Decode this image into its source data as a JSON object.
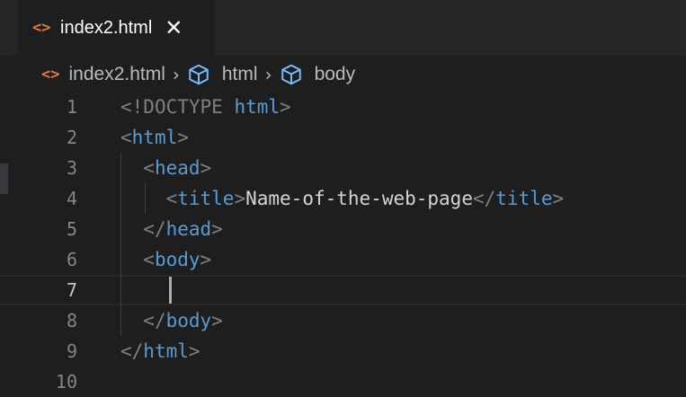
{
  "tab": {
    "label": "index2.html",
    "icon": "html-file-icon",
    "icon_glyph": "<>",
    "close_glyph": "✕"
  },
  "breadcrumb": {
    "file": "index2.html",
    "items": [
      "html",
      "body"
    ],
    "separator": "›"
  },
  "editor": {
    "line_numbers": [
      "1",
      "2",
      "3",
      "4",
      "5",
      "6",
      "7",
      "8",
      "9",
      "10"
    ],
    "active_line": "7",
    "lines": [
      [
        [
          "p",
          "<"
        ],
        [
          "p",
          "!DOCTYPE"
        ],
        [
          "x",
          " "
        ],
        [
          "t",
          "html"
        ],
        [
          "p",
          ">"
        ]
      ],
      [
        [
          "p",
          "<"
        ],
        [
          "t",
          "html"
        ],
        [
          "p",
          ">"
        ]
      ],
      [
        [
          "x",
          "  "
        ],
        [
          "p",
          "<"
        ],
        [
          "t",
          "head"
        ],
        [
          "p",
          ">"
        ]
      ],
      [
        [
          "x",
          "    "
        ],
        [
          "p",
          "<"
        ],
        [
          "t",
          "title"
        ],
        [
          "p",
          ">"
        ],
        [
          "x",
          "Name-of-the-web-page"
        ],
        [
          "p",
          "</"
        ],
        [
          "t",
          "title"
        ],
        [
          "p",
          ">"
        ]
      ],
      [
        [
          "x",
          "  "
        ],
        [
          "p",
          "</"
        ],
        [
          "t",
          "head"
        ],
        [
          "p",
          ">"
        ]
      ],
      [
        [
          "x",
          "  "
        ],
        [
          "p",
          "<"
        ],
        [
          "t",
          "body"
        ],
        [
          "p",
          ">"
        ]
      ],
      [
        [
          "x",
          ""
        ]
      ],
      [
        [
          "x",
          "  "
        ],
        [
          "p",
          "</"
        ],
        [
          "t",
          "body"
        ],
        [
          "p",
          ">"
        ]
      ],
      [
        [
          "p",
          "</"
        ],
        [
          "t",
          "html"
        ],
        [
          "p",
          ">"
        ]
      ],
      [
        [
          "x",
          ""
        ]
      ]
    ]
  },
  "colors": {
    "background": "#1e1e1e",
    "tag": "#569cd6",
    "punctuation": "#808080",
    "text": "#d4d4d4",
    "file_icon": "#e37933",
    "breadcrumb_icon": "#75beff"
  }
}
